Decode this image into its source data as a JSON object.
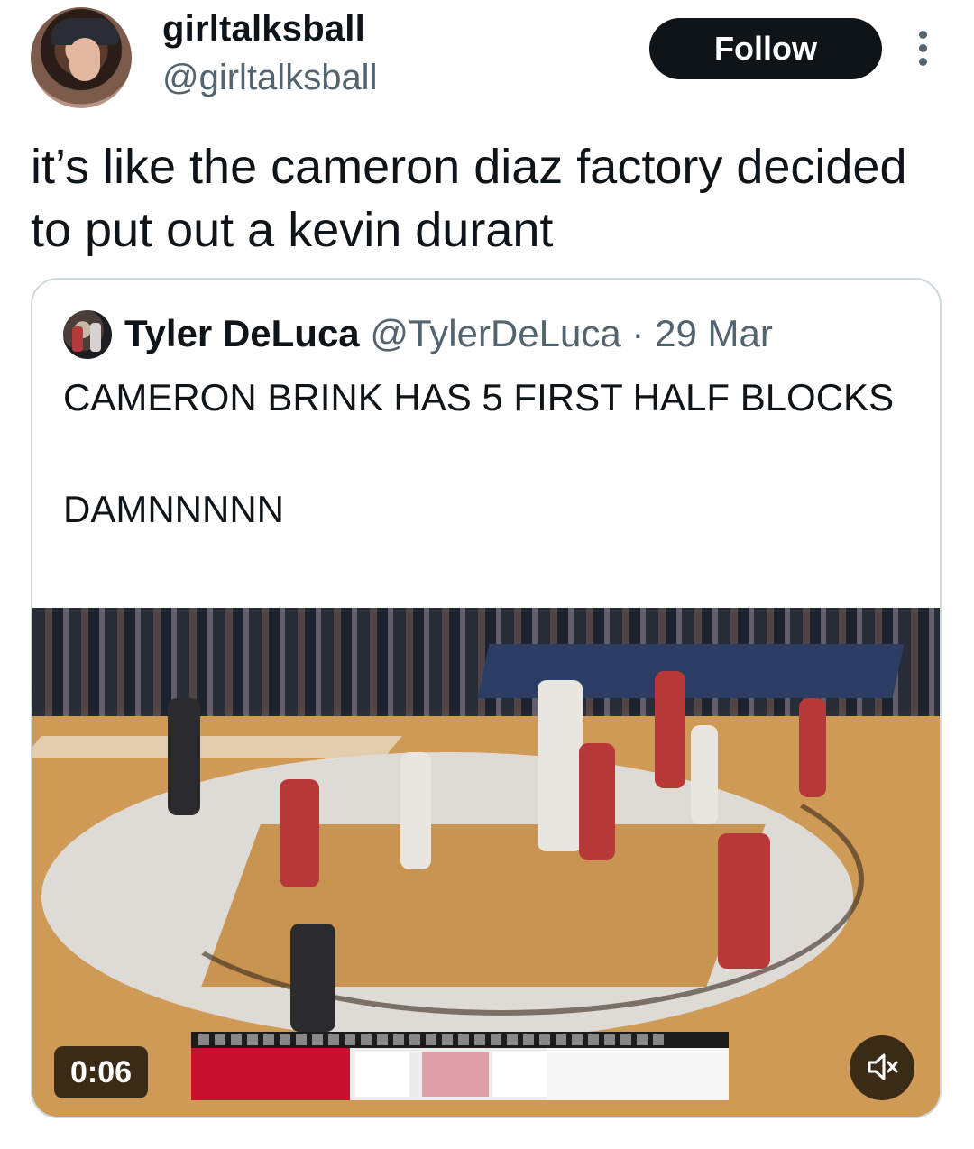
{
  "author": {
    "display_name": "girltalksball",
    "handle": "@girltalksball",
    "avatar_icon": "profile-photo"
  },
  "follow_label": "Follow",
  "tweet_text": "it’s like the cameron diaz factory decided to put out a kevin durant",
  "quote": {
    "author_name": "Tyler DeLuca",
    "handle": "@TylerDeLuca",
    "separator": "·",
    "date": "29 Mar",
    "text": "CAMERON BRINK HAS 5 FIRST HALF BLOCKS\n\nDAMNNNNN",
    "video": {
      "timer": "0:06",
      "mute_icon": "speaker-muted-icon"
    }
  },
  "colors": {
    "follow_bg": "#0f1419",
    "secondary_text": "#536471",
    "border": "#cfd9de",
    "nc_state_red": "#c8102e"
  }
}
